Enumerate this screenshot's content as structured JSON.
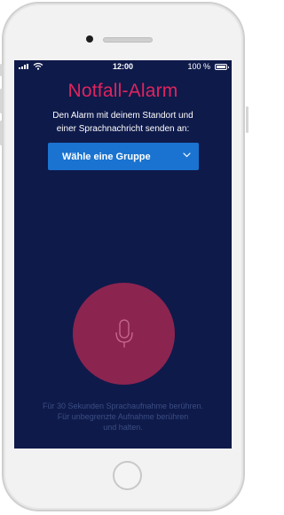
{
  "status_bar": {
    "time": "12:00",
    "battery_pct": "100 %",
    "signal_icon": "signal-bars-icon",
    "wifi_icon": "wifi-icon",
    "battery_icon": "battery-icon"
  },
  "screen": {
    "title": "Notfall-Alarm",
    "subtitle_line1": "Den Alarm mit deinem Standort und",
    "subtitle_line2": "einer Sprachnachricht senden an:",
    "group_select": {
      "label": "Wähle eine Gruppe",
      "icon": "chevron-down-icon"
    },
    "mic_button": {
      "icon": "microphone-icon"
    },
    "hint_line1": "Für 30 Sekunden Sprachaufnahme berühren.",
    "hint_line2": "Für unbegrenzte Aufnahme berühren",
    "hint_line3": "und halten."
  },
  "colors": {
    "background": "#0e1a4a",
    "accent_title": "#e0245e",
    "select_blue": "#1a73d0",
    "mic_circle": "#8c2450",
    "hint_text": "#3b4d82"
  }
}
